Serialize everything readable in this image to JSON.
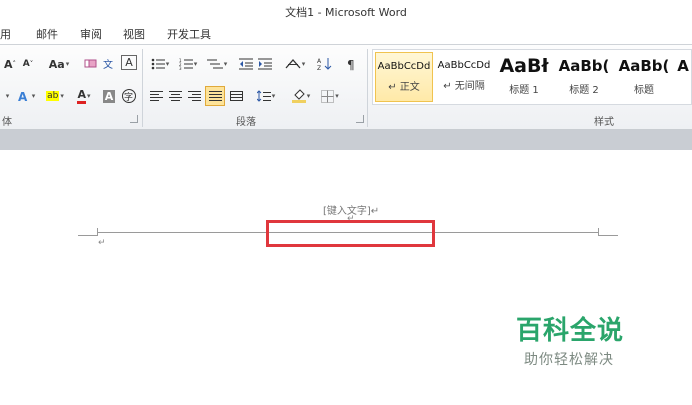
{
  "window": {
    "title": "文档1 - Microsoft Word"
  },
  "tabs": [
    "用",
    "邮件",
    "审阅",
    "视图",
    "开发工具"
  ],
  "ribbon": {
    "font_group": {
      "label": "体",
      "row1": {
        "grow_font": "A",
        "shrink_font": "A",
        "change_case": "Aa",
        "char_border": "A"
      },
      "row2": {
        "highlight_label": "ab",
        "font_color_label": "A",
        "char_shading": "A",
        "enclose_char": "字"
      }
    },
    "paragraph_group": {
      "label": "段落"
    },
    "styles_group": {
      "label": "样式",
      "items": [
        {
          "sample": "AaBbCcDd",
          "name": "↵ 正文"
        },
        {
          "sample": "AaBbCcDd",
          "name": "↵ 无间隔"
        },
        {
          "sample": "AaBł",
          "name": "标题 1"
        },
        {
          "sample": "AaBb(",
          "name": "标题 2"
        },
        {
          "sample": "AaBb(",
          "name": "标题"
        },
        {
          "sample": "A",
          "name": ""
        }
      ]
    }
  },
  "document": {
    "header_placeholder": "[键入文字]↵",
    "para_mark": "↵",
    "highlight_color": "#e0373d"
  },
  "watermark": {
    "title": "百科全说",
    "subtitle": "助你轻松解决",
    "color": "#2aa56b"
  }
}
